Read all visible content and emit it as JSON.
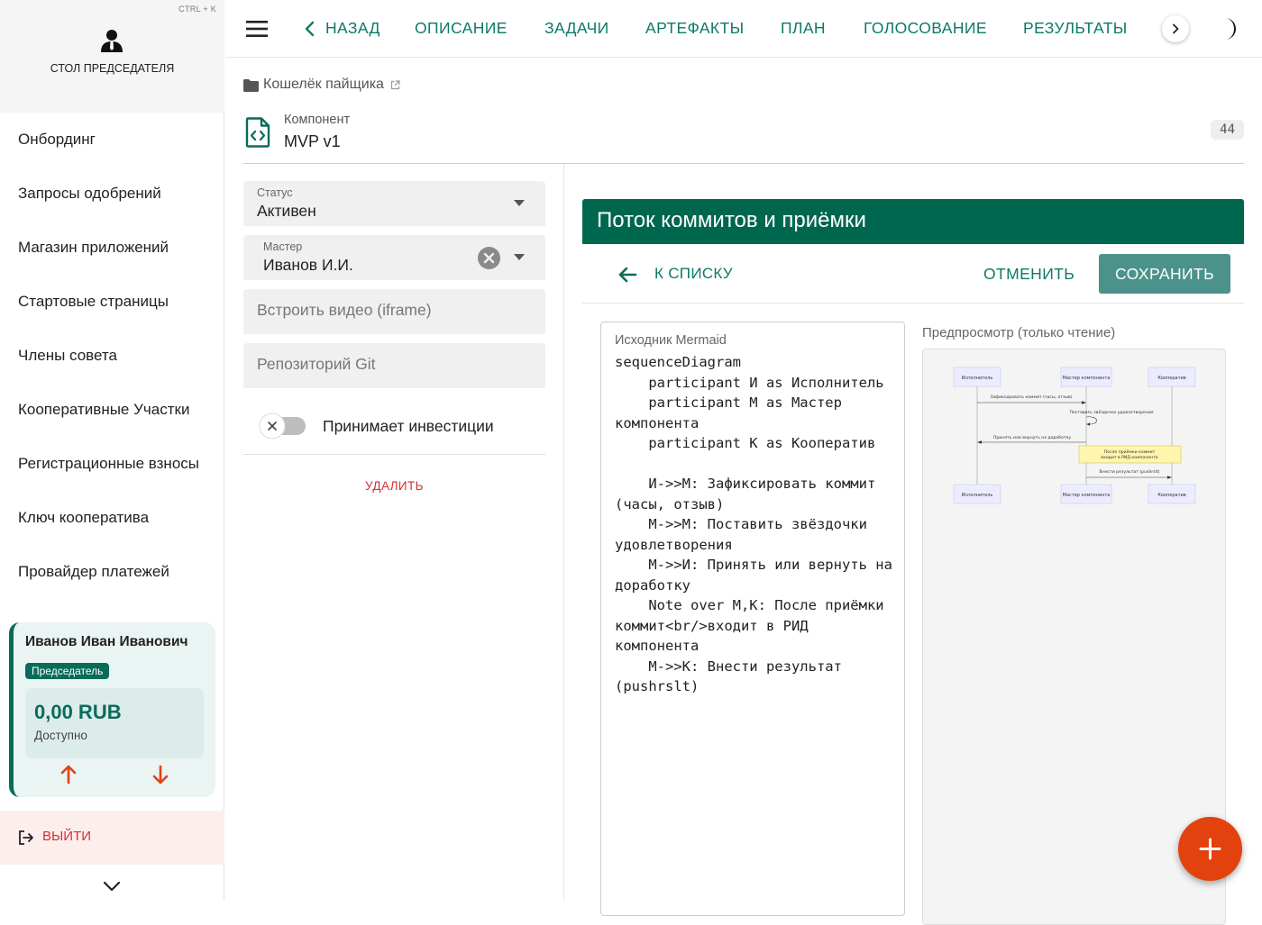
{
  "sidebar": {
    "shortcut": "CTRL + K",
    "role_title": "СТОЛ ПРЕДСЕДАТЕЛЯ",
    "items": [
      {
        "label": "Онбординг"
      },
      {
        "label": "Запросы одобрений"
      },
      {
        "label": "Магазин приложений"
      },
      {
        "label": "Стартовые страницы"
      },
      {
        "label": "Члены совета"
      },
      {
        "label": "Кооперативные Участки"
      },
      {
        "label": "Регистрационные взносы"
      },
      {
        "label": "Ключ кооператива"
      },
      {
        "label": "Провайдер платежей"
      }
    ],
    "user": {
      "name": "Иванов Иван Иванович",
      "badge": "Председатель",
      "amount": "0,00 RUB",
      "available": "Доступно"
    },
    "logout": "ВЫЙТИ"
  },
  "topbar": {
    "tabs": [
      {
        "label": "НАЗАД"
      },
      {
        "label": "ОПИСАНИЕ"
      },
      {
        "label": "ЗАДАЧИ"
      },
      {
        "label": "АРТЕФАКТЫ"
      },
      {
        "label": "ПЛАН"
      },
      {
        "label": "ГОЛОСОВАНИЕ"
      },
      {
        "label": "РЕЗУЛЬТАТЫ"
      }
    ]
  },
  "breadcrumb": {
    "project": "Кошелёк пайщика"
  },
  "component": {
    "kind": "Компонент",
    "name": "MVP v1",
    "count": "44"
  },
  "form": {
    "status": {
      "label": "Статус",
      "value": "Активен"
    },
    "master": {
      "label": "Мастер",
      "value": "Иванов И.И."
    },
    "video_placeholder": "Встроить видео (iframe)",
    "git_placeholder": "Репозиторий Git",
    "investments_label": "Принимает инвестиции",
    "delete": "УДАЛИТЬ"
  },
  "panel": {
    "title": "Поток коммитов и приёмки",
    "back": "К СПИСКУ",
    "cancel": "ОТМЕНИТЬ",
    "save": "СОХРАНИТЬ",
    "editor_label": "Исходник Mermaid",
    "code": "sequenceDiagram\n    participant И as Исполнитель\n    participant М as Мастер компонента\n    participant К as Кооператив\n\n    И->>М: Зафиксировать коммит (часы, отзыв)\n    М->>М: Поставить звёздочки удовлетворения\n    М->>И: Принять или вернуть на доработку\n    Note over М,К: После приёмки коммит<br/>входит в РИД компонента\n    М->>К: Внести результат (pushrslt)",
    "preview_label": "Предпросмотр (только чтение)"
  },
  "diagram": {
    "participants": [
      "Исполнитель",
      "Мастер компонента",
      "Кооператив"
    ],
    "messages": [
      "Зафиксировать коммит (часы, отзыв)",
      "Поставить звёздочки удовлетворения",
      "Принять или вернуть на доработку",
      "Внести результат (pushrslt)"
    ],
    "note_line1": "После приёмки коммит",
    "note_line2": "входит в РИД компонента"
  },
  "colors": {
    "accent": "#0b7a66",
    "header": "#00674f",
    "danger": "#d32f2f",
    "fab": "#e3410d"
  }
}
